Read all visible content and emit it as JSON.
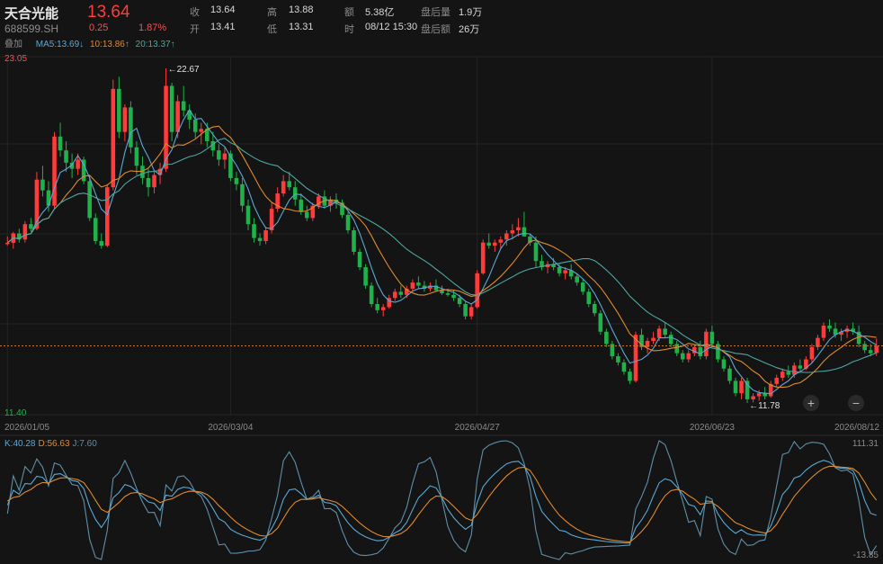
{
  "stock": {
    "name": "天合光能",
    "code": "688599.SH",
    "price": "13.64",
    "change": "0.25",
    "change_pct": "1.87%"
  },
  "quote": {
    "close_label": "收",
    "close": "13.64",
    "open_label": "开",
    "open": "13.41",
    "high_label": "高",
    "high": "13.88",
    "low_label": "低",
    "low": "13.31",
    "amount_label": "额",
    "amount": "5.38亿",
    "time_label": "时",
    "time": "08/12 15:30",
    "ah_vol_label": "盘后量",
    "ah_vol": "1.9万",
    "ah_amt_label": "盘后额",
    "ah_amt": "26万"
  },
  "ma": {
    "overlay_label": "叠加",
    "ma5": "MA5:13.69↓",
    "ma10": "10:13.86↑",
    "ma20": "20:13.37↑"
  },
  "colors": {
    "up": "#ff3b3b",
    "down": "#1fb14a",
    "ma5": "#5aa9d6",
    "ma10": "#e08a2e",
    "ma20": "#4fa6a0",
    "k": "#5aa9d6",
    "d": "#e08a2e",
    "j": "#5f8fa8"
  },
  "chart_data": [
    {
      "type": "candlestick",
      "title": "",
      "ylim": [
        11.4,
        23.05
      ],
      "axis_top_label": "23.05",
      "axis_bottom_label": "11.40",
      "max_annotation": "←22.67",
      "min_annotation": "←11.78",
      "x_tick_labels": [
        "2026/01/05",
        "2026/03/04",
        "2026/04/27",
        "2026/06/23",
        "2026/08/12"
      ],
      "x_tick_index": [
        0,
        38,
        80,
        120,
        161
      ],
      "last_close": 13.64,
      "series_ma": [
        {
          "name": "MA5",
          "value": 13.69
        },
        {
          "name": "MA10",
          "value": 13.86
        },
        {
          "name": "MA20",
          "value": 13.37
        }
      ],
      "ohlc": [
        [
          16.95,
          17.2,
          16.9,
          16.99
        ],
        [
          16.99,
          17.35,
          16.8,
          17.3
        ],
        [
          17.3,
          17.45,
          17.0,
          17.1
        ],
        [
          17.1,
          17.7,
          17.0,
          17.6
        ],
        [
          17.6,
          17.8,
          17.35,
          17.45
        ],
        [
          17.45,
          19.3,
          17.4,
          19.05
        ],
        [
          19.05,
          19.5,
          18.5,
          18.7
        ],
        [
          18.7,
          19.0,
          18.0,
          18.2
        ],
        [
          18.2,
          20.6,
          18.1,
          20.45
        ],
        [
          20.45,
          20.9,
          19.8,
          20.0
        ],
        [
          20.0,
          20.3,
          19.3,
          19.6
        ],
        [
          19.6,
          19.9,
          19.1,
          19.4
        ],
        [
          19.4,
          19.9,
          19.2,
          19.7
        ],
        [
          19.7,
          19.8,
          18.9,
          19.0
        ],
        [
          19.0,
          19.2,
          17.7,
          17.8
        ],
        [
          17.8,
          17.95,
          16.95,
          17.05
        ],
        [
          17.05,
          17.3,
          16.8,
          16.9
        ],
        [
          16.9,
          18.9,
          16.85,
          18.8
        ],
        [
          18.8,
          22.3,
          18.7,
          22.0
        ],
        [
          22.0,
          22.4,
          20.4,
          20.6
        ],
        [
          20.6,
          21.5,
          20.3,
          21.4
        ],
        [
          21.4,
          21.6,
          19.9,
          20.1
        ],
        [
          20.1,
          20.3,
          19.2,
          19.5
        ],
        [
          19.5,
          19.8,
          18.9,
          19.1
        ],
        [
          19.1,
          19.4,
          18.5,
          18.8
        ],
        [
          18.8,
          19.3,
          18.6,
          19.2
        ],
        [
          19.2,
          19.6,
          18.9,
          19.4
        ],
        [
          19.4,
          22.67,
          19.3,
          22.1
        ],
        [
          22.1,
          22.2,
          20.3,
          20.6
        ],
        [
          20.6,
          21.8,
          20.4,
          21.6
        ],
        [
          21.6,
          22.1,
          21.1,
          21.3
        ],
        [
          21.3,
          21.5,
          20.7,
          21.0
        ],
        [
          21.0,
          21.2,
          20.4,
          20.6
        ],
        [
          20.6,
          20.9,
          20.2,
          20.7
        ],
        [
          20.7,
          20.9,
          20.1,
          20.3
        ],
        [
          20.3,
          20.6,
          19.8,
          20.0
        ],
        [
          20.0,
          20.2,
          19.5,
          19.7
        ],
        [
          19.7,
          20.1,
          19.4,
          19.9
        ],
        [
          19.9,
          20.0,
          19.0,
          19.1
        ],
        [
          19.1,
          19.3,
          18.7,
          18.9
        ],
        [
          18.9,
          19.1,
          18.0,
          18.2
        ],
        [
          18.2,
          18.4,
          17.4,
          17.6
        ],
        [
          17.6,
          17.8,
          17.0,
          17.15
        ],
        [
          17.15,
          17.3,
          16.9,
          17.05
        ],
        [
          17.05,
          17.5,
          16.95,
          17.4
        ],
        [
          17.4,
          18.3,
          17.3,
          18.1
        ],
        [
          18.1,
          18.8,
          18.0,
          18.6
        ],
        [
          18.6,
          19.2,
          18.5,
          19.0
        ],
        [
          19.0,
          19.3,
          18.7,
          18.8
        ],
        [
          18.8,
          19.0,
          18.2,
          18.4
        ],
        [
          18.4,
          18.6,
          17.9,
          18.0
        ],
        [
          18.0,
          18.2,
          17.7,
          17.8
        ],
        [
          17.8,
          18.3,
          17.7,
          18.2
        ],
        [
          18.2,
          18.6,
          18.1,
          18.5
        ],
        [
          18.5,
          18.7,
          18.1,
          18.2
        ],
        [
          18.2,
          18.5,
          18.0,
          18.4
        ],
        [
          18.4,
          18.6,
          18.1,
          18.3
        ],
        [
          18.3,
          18.4,
          17.8,
          17.9
        ],
        [
          17.9,
          18.0,
          17.3,
          17.4
        ],
        [
          17.4,
          17.5,
          16.6,
          16.7
        ],
        [
          16.7,
          16.8,
          16.1,
          16.2
        ],
        [
          16.2,
          16.3,
          15.5,
          15.6
        ],
        [
          15.6,
          15.7,
          14.9,
          15.0
        ],
        [
          15.0,
          15.2,
          14.7,
          14.8
        ],
        [
          14.8,
          15.0,
          14.6,
          14.9
        ],
        [
          14.9,
          15.3,
          14.85,
          15.2
        ],
        [
          15.2,
          15.5,
          15.1,
          15.4
        ],
        [
          15.4,
          15.6,
          15.2,
          15.3
        ],
        [
          15.3,
          15.6,
          15.2,
          15.5
        ],
        [
          15.5,
          15.8,
          15.4,
          15.7
        ],
        [
          15.7,
          15.9,
          15.5,
          15.6
        ],
        [
          15.6,
          15.75,
          15.4,
          15.5
        ],
        [
          15.5,
          15.7,
          15.4,
          15.6
        ],
        [
          15.6,
          15.8,
          15.4,
          15.45
        ],
        [
          15.45,
          15.6,
          15.3,
          15.35
        ],
        [
          15.35,
          15.5,
          15.25,
          15.3
        ],
        [
          15.3,
          15.45,
          15.1,
          15.2
        ],
        [
          15.2,
          15.3,
          14.9,
          15.0
        ],
        [
          15.0,
          15.1,
          14.5,
          14.6
        ],
        [
          14.6,
          15.0,
          14.5,
          14.9
        ],
        [
          14.9,
          16.1,
          14.85,
          16.0
        ],
        [
          16.0,
          17.1,
          15.95,
          17.0
        ],
        [
          17.0,
          17.3,
          16.8,
          16.9
        ],
        [
          16.9,
          17.1,
          16.7,
          17.0
        ],
        [
          17.0,
          17.2,
          16.8,
          17.1
        ],
        [
          17.1,
          17.4,
          16.9,
          17.3
        ],
        [
          17.3,
          17.6,
          17.1,
          17.4
        ],
        [
          17.4,
          17.8,
          17.2,
          17.5
        ],
        [
          17.5,
          18.0,
          17.3,
          17.2
        ],
        [
          17.2,
          17.3,
          16.9,
          17.0
        ],
        [
          17.0,
          17.2,
          16.2,
          16.4
        ],
        [
          16.4,
          16.6,
          16.1,
          16.2
        ],
        [
          16.2,
          16.4,
          16.0,
          16.3
        ],
        [
          16.3,
          16.5,
          16.1,
          16.2
        ],
        [
          16.2,
          16.3,
          15.9,
          16.0
        ],
        [
          16.0,
          16.2,
          15.8,
          16.1
        ],
        [
          16.1,
          16.3,
          15.8,
          15.9
        ],
        [
          15.9,
          16.0,
          15.6,
          15.7
        ],
        [
          15.7,
          15.8,
          15.3,
          15.4
        ],
        [
          15.4,
          15.5,
          14.9,
          15.0
        ],
        [
          15.0,
          15.1,
          14.6,
          14.7
        ],
        [
          14.7,
          14.8,
          14.0,
          14.1
        ],
        [
          14.1,
          14.2,
          13.6,
          13.7
        ],
        [
          13.7,
          13.8,
          13.2,
          13.3
        ],
        [
          13.3,
          13.4,
          13.0,
          13.1
        ],
        [
          13.1,
          13.2,
          12.7,
          12.8
        ],
        [
          12.8,
          12.9,
          12.4,
          12.5
        ],
        [
          12.5,
          14.1,
          12.45,
          14.0
        ],
        [
          14.0,
          14.2,
          13.5,
          13.6
        ],
        [
          13.6,
          13.9,
          13.4,
          13.8
        ],
        [
          13.8,
          14.1,
          13.7,
          13.9
        ],
        [
          13.9,
          14.3,
          13.8,
          14.2
        ],
        [
          14.2,
          14.4,
          13.9,
          14.0
        ],
        [
          14.0,
          14.1,
          13.6,
          13.7
        ],
        [
          13.7,
          13.8,
          13.3,
          13.4
        ],
        [
          13.4,
          13.5,
          13.1,
          13.2
        ],
        [
          13.2,
          13.5,
          13.1,
          13.4
        ],
        [
          13.4,
          13.7,
          13.3,
          13.6
        ],
        [
          13.6,
          13.8,
          13.2,
          13.3
        ],
        [
          13.3,
          14.2,
          13.2,
          14.1
        ],
        [
          14.1,
          14.3,
          13.6,
          13.7
        ],
        [
          13.7,
          13.8,
          13.1,
          13.2
        ],
        [
          13.2,
          13.3,
          12.8,
          12.9
        ],
        [
          12.9,
          13.0,
          12.4,
          12.5
        ],
        [
          12.5,
          12.6,
          12.0,
          12.1
        ],
        [
          12.1,
          12.6,
          11.9,
          12.5
        ],
        [
          12.5,
          12.6,
          11.78,
          11.9
        ],
        [
          11.9,
          12.1,
          11.8,
          12.0
        ],
        [
          12.0,
          12.2,
          11.85,
          12.1
        ],
        [
          12.1,
          12.3,
          11.9,
          12.0
        ],
        [
          12.0,
          12.5,
          11.95,
          12.4
        ],
        [
          12.4,
          12.7,
          12.3,
          12.6
        ],
        [
          12.6,
          12.9,
          12.5,
          12.8
        ],
        [
          12.8,
          13.0,
          12.6,
          12.7
        ],
        [
          12.7,
          13.1,
          12.6,
          13.0
        ],
        [
          13.0,
          13.2,
          12.8,
          12.9
        ],
        [
          12.9,
          13.3,
          12.85,
          13.2
        ],
        [
          13.2,
          13.7,
          13.1,
          13.6
        ],
        [
          13.6,
          14.0,
          13.5,
          13.9
        ],
        [
          13.9,
          14.4,
          13.8,
          14.3
        ],
        [
          14.3,
          14.5,
          14.1,
          14.2
        ],
        [
          14.2,
          14.4,
          13.9,
          14.0
        ],
        [
          14.0,
          14.2,
          13.8,
          14.1
        ],
        [
          14.1,
          14.3,
          13.9,
          14.2
        ],
        [
          14.2,
          14.4,
          14.0,
          14.1
        ],
        [
          14.1,
          14.3,
          13.6,
          13.7
        ],
        [
          13.7,
          13.8,
          13.4,
          13.5
        ],
        [
          13.5,
          13.7,
          13.3,
          13.4
        ],
        [
          13.41,
          13.88,
          13.31,
          13.64
        ]
      ]
    },
    {
      "type": "line",
      "title": "KDJ",
      "ylim": [
        -13.85,
        111.31
      ],
      "axis_top_label": "111.31",
      "axis_bottom_label": "-13.85",
      "legend": {
        "k": "K:40.28",
        "d": "D:56.63",
        "j": "J:7.60"
      }
    }
  ],
  "controls": {
    "zoom_in": "+",
    "zoom_out": "−"
  }
}
